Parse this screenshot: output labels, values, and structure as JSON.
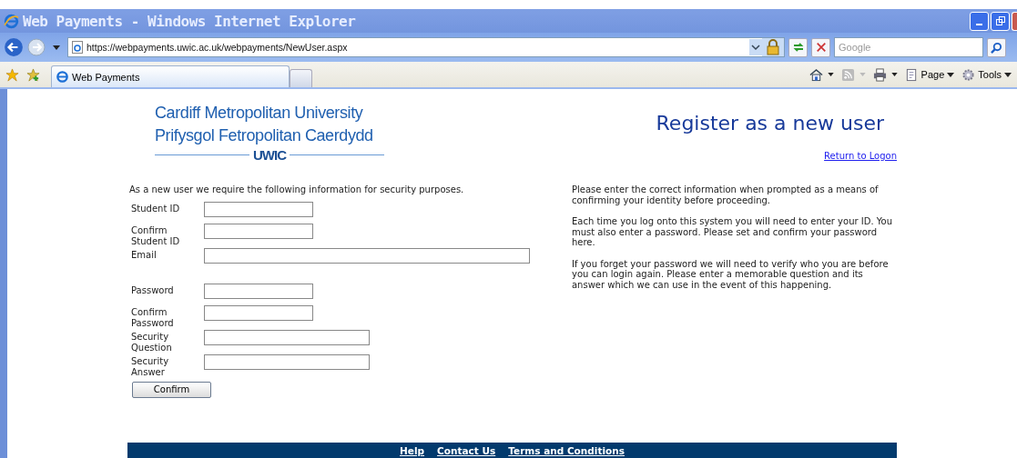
{
  "window": {
    "title": "Web Payments - Windows Internet Explorer"
  },
  "address_bar": {
    "url": "https://webpayments.uwic.ac.uk/webpayments/NewUser.aspx"
  },
  "search": {
    "placeholder": "Google"
  },
  "tabs": [
    {
      "label": "Web Payments",
      "selected": true
    }
  ],
  "command_bar": {
    "items": [
      {
        "label": "Page",
        "kind": "page"
      },
      {
        "label": "Tools",
        "kind": "tools"
      }
    ]
  },
  "logo": {
    "line_1": "Cardiff Metropolitan University",
    "line_2": "Prifysgol Fetropolitan Caerdydd",
    "mark": "UWIC"
  },
  "heading": "Register as a new user",
  "return_link": "Return to Logon",
  "intro": "As a new user we require the following information for security purposes.",
  "fields": [
    {
      "label": "Student ID"
    },
    {
      "label": "Confirm Student ID"
    },
    {
      "label": "Email"
    },
    {
      "label": "Password"
    },
    {
      "label": "Confirm Password"
    },
    {
      "label": "Security Question"
    },
    {
      "label": "Security Answer"
    }
  ],
  "confirm_button": "Confirm",
  "help_paragraphs": [
    "Please enter the correct information when prompted as a means of confirming your identity before proceeding.",
    "Each time you log onto this system you will need to enter your ID. You must also enter a password. Please set and confirm your password here.",
    "If you forget your password we will need to verify who you are before you can login again. Please enter a memorable question and its answer which we can use in the event of this happening."
  ],
  "footer_links": [
    "Help",
    "Contact Us",
    "Terms and Conditions"
  ]
}
